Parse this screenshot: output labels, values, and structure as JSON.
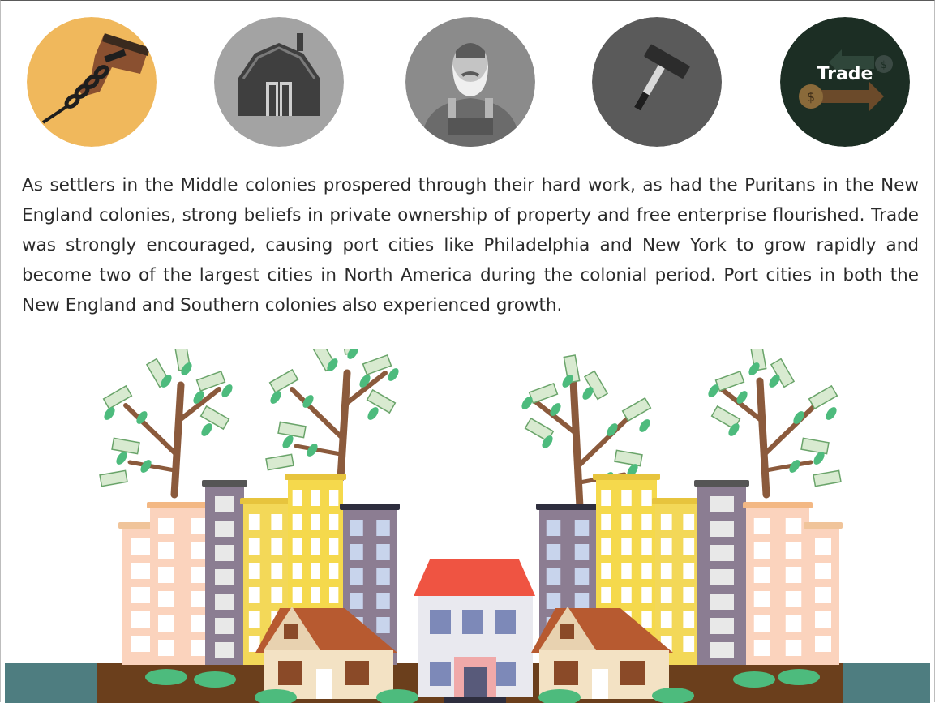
{
  "icons": [
    {
      "name": "slavery-chain-hand-icon",
      "bg": "#f0b85c"
    },
    {
      "name": "barn-icon",
      "bg": "#a3a3a3"
    },
    {
      "name": "farmer-icon",
      "bg": "#8b8b8b"
    },
    {
      "name": "hammer-icon",
      "bg": "#5a5a5a"
    },
    {
      "name": "trade-icon",
      "bg": "#1c2e24",
      "label": "Trade"
    }
  ],
  "paragraph": "As settlers in the Middle colonies prospered through their hard work,  as had the Puritans in the New England colonies, strong beliefs in private ownership of property and free enterprise flourished. Trade was strongly encouraged, causing port cities like Philadelphia and New York to grow rapidly and become two of the largest cities in North America during the colonial period. Port cities in both the New England and Southern colonies also experienced growth.",
  "colors": {
    "text": "#2a2a2a",
    "water": "#4e7d80",
    "ground": "#6b3f1c",
    "money_green": "#d8ead0",
    "leaf": "#4dbb7d",
    "trunk": "#8b5a3c",
    "roof_red": "#ef5442"
  }
}
